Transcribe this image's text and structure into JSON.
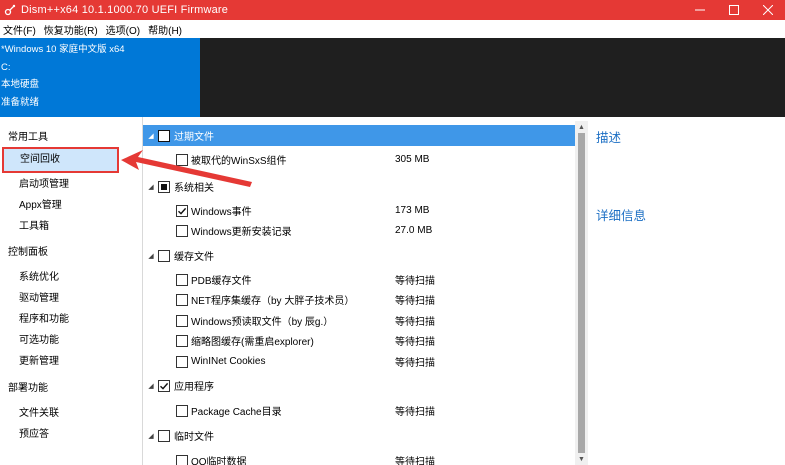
{
  "window": {
    "title": "Dism++x64 10.1.1000.70 UEFI Firmware"
  },
  "menu": [
    "文件(F)",
    "恢复功能(R)",
    "选项(O)",
    "帮助(H)"
  ],
  "info": [
    "*Windows 10 家庭中文版 x64",
    "C:",
    "本地硬盘",
    "准备就绪"
  ],
  "sidebar": {
    "sections": [
      {
        "label": "常用工具",
        "items": [
          "空间回收",
          "启动项管理",
          "Appx管理",
          "工具箱"
        ]
      },
      {
        "label": "控制面板",
        "items": [
          "系统优化",
          "驱动管理",
          "程序和功能",
          "可选功能",
          "更新管理"
        ]
      },
      {
        "label": "部署功能",
        "items": [
          "文件关联",
          "预应答"
        ]
      }
    ]
  },
  "list": {
    "rows": [
      {
        "kind": "group",
        "label": "过期文件",
        "check": "none",
        "size": ""
      },
      {
        "kind": "child",
        "label": "被取代的WinSxS组件",
        "check": "none",
        "size": "305 MB"
      },
      {
        "kind": "group",
        "label": "系统相关",
        "check": "partial",
        "size": ""
      },
      {
        "kind": "child",
        "label": "Windows事件",
        "check": "checked",
        "size": "173 MB"
      },
      {
        "kind": "child",
        "label": "Windows更新安装记录",
        "check": "none",
        "size": "27.0 MB"
      },
      {
        "kind": "group",
        "label": "缓存文件",
        "check": "none",
        "size": ""
      },
      {
        "kind": "child",
        "label": "PDB缓存文件",
        "check": "none",
        "size": "等待扫描"
      },
      {
        "kind": "child",
        "label": "NET程序集缓存（by 大胖子技术员）",
        "check": "none",
        "size": "等待扫描"
      },
      {
        "kind": "child",
        "label": "Windows预读取文件（by 辰g.）",
        "check": "none",
        "size": "等待扫描"
      },
      {
        "kind": "child",
        "label": "缩略图缓存(需重启explorer)",
        "check": "none",
        "size": "等待扫描"
      },
      {
        "kind": "child",
        "label": "WinINet Cookies",
        "check": "none",
        "size": "等待扫描"
      },
      {
        "kind": "group",
        "label": "应用程序",
        "check": "checked",
        "size": ""
      },
      {
        "kind": "child",
        "label": "Package Cache目录",
        "check": "none",
        "size": "等待扫描"
      },
      {
        "kind": "group",
        "label": "临时文件",
        "check": "none",
        "size": ""
      },
      {
        "kind": "child",
        "label": "QQ临时数据",
        "check": "none",
        "size": "等待扫描"
      }
    ]
  },
  "right": {
    "description": "描述",
    "details": "详细信息"
  },
  "colors": {
    "titlebar": "#e53935",
    "info_panel": "#0078d7",
    "selection": "#3f97e8",
    "annotation": "#e53935",
    "heading": "#1c6fc4"
  }
}
